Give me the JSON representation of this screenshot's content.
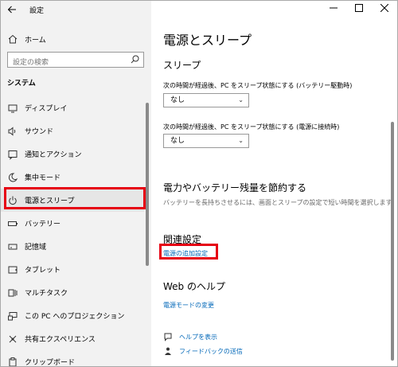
{
  "window": {
    "title": "設定"
  },
  "sidebar": {
    "home_label": "ホーム",
    "search_placeholder": "設定の検索",
    "section_title": "システム",
    "items": [
      {
        "label": "ディスプレイ",
        "icon": "monitor-icon"
      },
      {
        "label": "サウンド",
        "icon": "speaker-icon"
      },
      {
        "label": "通知とアクション",
        "icon": "notification-icon"
      },
      {
        "label": "集中モード",
        "icon": "moon-icon"
      },
      {
        "label": "電源とスリープ",
        "icon": "power-icon",
        "selected": true
      },
      {
        "label": "バッテリー",
        "icon": "battery-icon"
      },
      {
        "label": "記憶域",
        "icon": "storage-icon"
      },
      {
        "label": "タブレット",
        "icon": "tablet-icon"
      },
      {
        "label": "マルチタスク",
        "icon": "multitask-icon"
      },
      {
        "label": "この PC へのプロジェクション",
        "icon": "projection-icon"
      },
      {
        "label": "共有エクスペリエンス",
        "icon": "shared-experience-icon"
      },
      {
        "label": "クリップボード",
        "icon": "clipboard-icon"
      }
    ]
  },
  "main": {
    "page_title": "電源とスリープ",
    "sleep": {
      "heading": "スリープ",
      "battery_label": "次の時間が経過後、PC をスリープ状態にする (バッテリー駆動時)",
      "battery_value": "なし",
      "plugged_label": "次の時間が経過後、PC をスリープ状態にする (電源に接続時)",
      "plugged_value": "なし"
    },
    "save": {
      "heading": "電力やバッテリー残量を節約する",
      "description": "バッテリーを長持ちさせるには、画面とスリープの設定で短い時間を選択します。"
    },
    "related": {
      "heading": "関連設定",
      "link": "電源の追加設定"
    },
    "web_help": {
      "heading": "Web のヘルプ",
      "link": "電源モードの変更"
    },
    "help": {
      "get_help": "ヘルプを表示",
      "feedback": "フィードバックの送信"
    }
  },
  "colors": {
    "highlight": "#e60012",
    "link": "#0067b8"
  }
}
